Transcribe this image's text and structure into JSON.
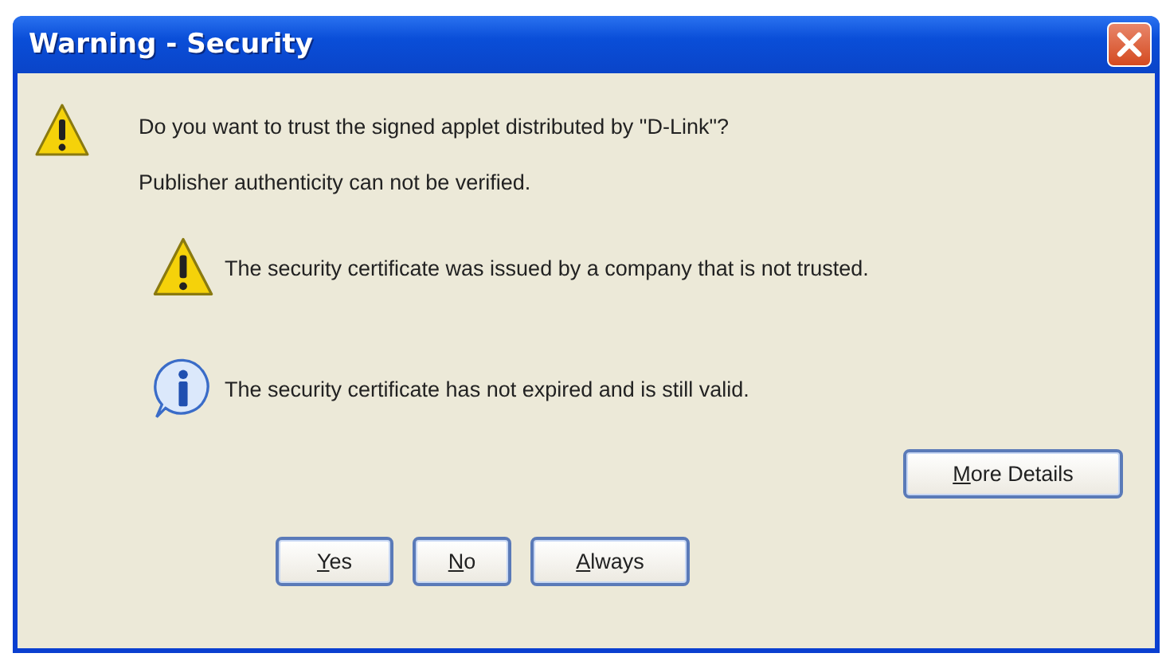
{
  "window": {
    "title": "Warning - Security"
  },
  "message": {
    "kind": "warning",
    "question": "Do you want to trust the signed applet distributed by \"D-Link\"?",
    "note": "Publisher authenticity can not be verified."
  },
  "details": [
    {
      "kind": "warning",
      "text": "The security certificate was issued by a company that is not trusted."
    },
    {
      "kind": "info",
      "text": "The security certificate has not expired and is still valid."
    }
  ],
  "more_button": "More Details",
  "buttons": [
    "Yes",
    "No",
    "Always"
  ]
}
